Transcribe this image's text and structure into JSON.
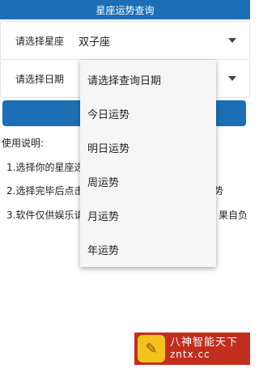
{
  "app": {
    "title": "星座运势查询"
  },
  "constellation": {
    "label": "请选择星座",
    "value": "双子座"
  },
  "date": {
    "label": "请选择日期"
  },
  "instructions": {
    "heading": "使用说明:",
    "line1": "1.选择你的星座选",
    "line1_tail": "",
    "line2": "2.选择完毕后点击",
    "line2_tail": "势",
    "line3": "3.软件仅供娱乐请",
    "line3_tail": "果自负"
  },
  "dropdown": {
    "options": [
      "请选择查询日期",
      "今日运势",
      "明日运势",
      "周运势",
      "月运势",
      "年运势"
    ]
  },
  "watermark": {
    "cn": "八神智能天下",
    "en": "zntx.cc"
  },
  "colors": {
    "primary": "#1c6fb5",
    "watermark": "#c22e1e",
    "logo": "#f3c21c"
  }
}
